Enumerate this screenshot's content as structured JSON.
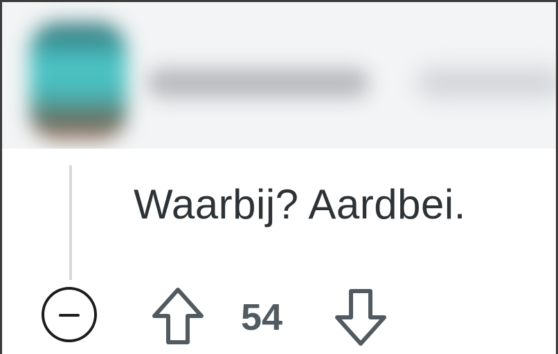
{
  "comment": {
    "text": "Waarbij? Aardbei."
  },
  "actions": {
    "score": "54",
    "collapse_icon": "minus-circle-icon",
    "upvote_icon": "arrow-up-outline-icon",
    "downvote_icon": "arrow-down-outline-icon"
  },
  "colors": {
    "text": "#2c3236",
    "score": "#515a60",
    "thread_line": "#d6d8da",
    "icon": "#1c1c1c",
    "header_bg": "#f2f4f5"
  }
}
